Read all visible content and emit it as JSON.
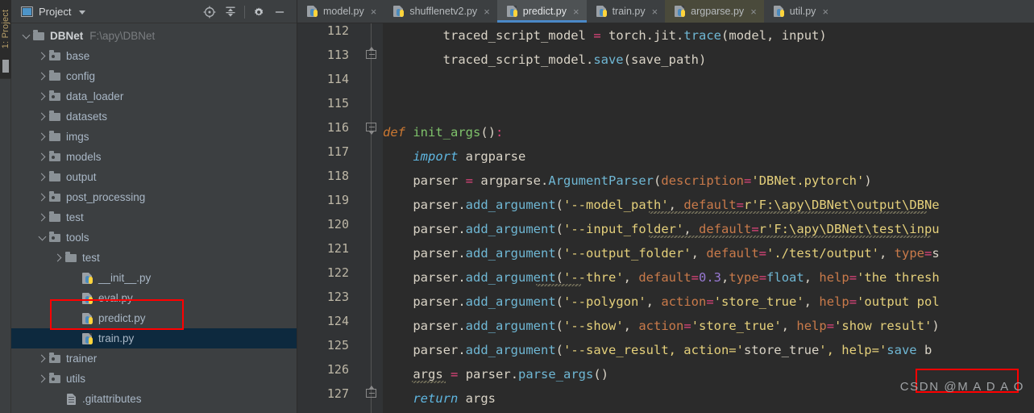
{
  "left_strip": {
    "label": "1: Project"
  },
  "project_panel": {
    "title": "Project",
    "tools": [
      {
        "name": "locate-target-icon",
        "label": "Select Opened File"
      },
      {
        "name": "collapse-all-icon",
        "label": "Collapse All"
      },
      {
        "name": "gear-icon",
        "label": "Settings"
      },
      {
        "name": "minimize-icon",
        "label": "Hide"
      }
    ],
    "tree": [
      {
        "label": "DBNet",
        "hint": "F:\\apy\\DBNet",
        "icon": "folder",
        "kind": "root",
        "depth": 0,
        "twisty": "open",
        "selected": false
      },
      {
        "label": "base",
        "hint": "",
        "icon": "folder-dot",
        "kind": "folder",
        "depth": 1,
        "twisty": "closed",
        "selected": false
      },
      {
        "label": "config",
        "hint": "",
        "icon": "folder",
        "kind": "folder",
        "depth": 1,
        "twisty": "closed",
        "selected": false
      },
      {
        "label": "data_loader",
        "hint": "",
        "icon": "folder-dot",
        "kind": "folder",
        "depth": 1,
        "twisty": "closed",
        "selected": false
      },
      {
        "label": "datasets",
        "hint": "",
        "icon": "folder",
        "kind": "folder",
        "depth": 1,
        "twisty": "closed",
        "selected": false
      },
      {
        "label": "imgs",
        "hint": "",
        "icon": "folder",
        "kind": "folder",
        "depth": 1,
        "twisty": "closed",
        "selected": false
      },
      {
        "label": "models",
        "hint": "",
        "icon": "folder-dot",
        "kind": "folder",
        "depth": 1,
        "twisty": "closed",
        "selected": false
      },
      {
        "label": "output",
        "hint": "",
        "icon": "folder",
        "kind": "folder",
        "depth": 1,
        "twisty": "closed",
        "selected": false
      },
      {
        "label": "post_processing",
        "hint": "",
        "icon": "folder-dot",
        "kind": "folder",
        "depth": 1,
        "twisty": "closed",
        "selected": false
      },
      {
        "label": "test",
        "hint": "",
        "icon": "folder",
        "kind": "folder",
        "depth": 1,
        "twisty": "closed",
        "selected": false
      },
      {
        "label": "tools",
        "hint": "",
        "icon": "folder-dot",
        "kind": "folder",
        "depth": 1,
        "twisty": "open",
        "selected": false
      },
      {
        "label": "test",
        "hint": "",
        "icon": "folder",
        "kind": "folder",
        "depth": 2,
        "twisty": "closed",
        "selected": false
      },
      {
        "label": "__init__.py",
        "hint": "",
        "icon": "python",
        "kind": "file",
        "depth": 3,
        "twisty": "none",
        "selected": false
      },
      {
        "label": "eval.py",
        "hint": "",
        "icon": "python",
        "kind": "file",
        "depth": 3,
        "twisty": "none",
        "selected": false
      },
      {
        "label": "predict.py",
        "hint": "",
        "icon": "python",
        "kind": "file",
        "depth": 3,
        "twisty": "none",
        "selected": false
      },
      {
        "label": "train.py",
        "hint": "",
        "icon": "python",
        "kind": "file",
        "depth": 3,
        "twisty": "none",
        "selected": true
      },
      {
        "label": "trainer",
        "hint": "",
        "icon": "folder-dot",
        "kind": "folder",
        "depth": 1,
        "twisty": "closed",
        "selected": false
      },
      {
        "label": "utils",
        "hint": "",
        "icon": "folder-dot",
        "kind": "folder",
        "depth": 1,
        "twisty": "closed",
        "selected": false
      },
      {
        "label": ".gitattributes",
        "hint": "",
        "icon": "doc",
        "kind": "file",
        "depth": 2,
        "twisty": "none",
        "selected": false
      }
    ]
  },
  "editor": {
    "tabs": [
      {
        "label": "model.py",
        "active": false,
        "library": false,
        "close": "×"
      },
      {
        "label": "shufflenetv2.py",
        "active": false,
        "library": false,
        "close": "×"
      },
      {
        "label": "predict.py",
        "active": true,
        "library": false,
        "close": "×"
      },
      {
        "label": "train.py",
        "active": false,
        "library": false,
        "close": "×"
      },
      {
        "label": "argparse.py",
        "active": false,
        "library": true,
        "close": "×"
      },
      {
        "label": "util.py",
        "active": false,
        "library": false,
        "close": "×"
      }
    ],
    "first_line_number": 112,
    "lines": [
      {
        "n": 112,
        "fold": "none",
        "text": "        traced_script_model = torch.jit.trace(model, input)"
      },
      {
        "n": 113,
        "fold": "end",
        "text": "        traced_script_model.save(save_path)"
      },
      {
        "n": 114,
        "fold": "none",
        "text": ""
      },
      {
        "n": 115,
        "fold": "none",
        "text": ""
      },
      {
        "n": 116,
        "fold": "start",
        "text": "def init_args():"
      },
      {
        "n": 117,
        "fold": "none",
        "text": "    import argparse"
      },
      {
        "n": 118,
        "fold": "none",
        "text": "    parser = argparse.ArgumentParser(description='DBNet.pytorch')"
      },
      {
        "n": 119,
        "fold": "none",
        "text": "    parser.add_argument('--model_path', default=r'F:\\apy\\DBNet\\output\\DBNe"
      },
      {
        "n": 120,
        "fold": "none",
        "text": "    parser.add_argument('--input_folder', default=r'F:\\apy\\DBNet\\test\\inpu"
      },
      {
        "n": 121,
        "fold": "none",
        "text": "    parser.add_argument('--output_folder', default='./test/output', type=s"
      },
      {
        "n": 122,
        "fold": "none",
        "text": "    parser.add_argument('--thre', default=0.3,type=float, help='the thresh"
      },
      {
        "n": 123,
        "fold": "none",
        "text": "    parser.add_argument('--polygon', action='store_true', help='output pol"
      },
      {
        "n": 124,
        "fold": "none",
        "text": "    parser.add_argument('--show', action='store_true', help='show result')"
      },
      {
        "n": 125,
        "fold": "none",
        "text": "    parser.add_argument('--save_result, action='store_true', help='save b"
      },
      {
        "n": 126,
        "fold": "none",
        "text": "    args = parser.parse_args()"
      },
      {
        "n": 127,
        "fold": "end",
        "text": "    return args"
      }
    ],
    "watermark": "CSDN @M A D A O"
  },
  "annotations": {
    "color": "#ff0000",
    "boxes": [
      {
        "name": "predict-py-tree-highlight",
        "target": "predict.py in project tree"
      },
      {
        "name": "save-result-code-highlight",
        "target": "--save_result argument on line 125"
      }
    ]
  }
}
